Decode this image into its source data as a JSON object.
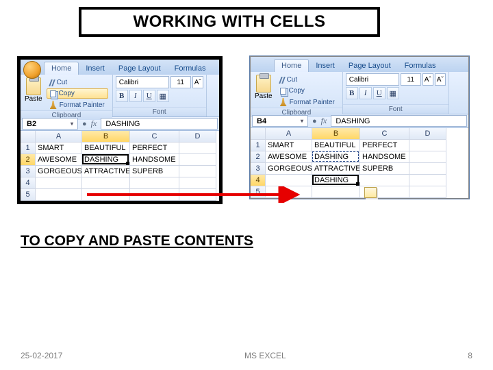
{
  "slide": {
    "title": "WORKING WITH CELLS",
    "subtitle": "TO COPY AND PASTE CONTENTS",
    "footer_date": "25-02-2017",
    "footer_center": "MS EXCEL",
    "footer_page": "8"
  },
  "ribbon": {
    "tabs": [
      "Home",
      "Insert",
      "Page Layout",
      "Formulas"
    ],
    "paste_label": "Paste",
    "cut_label": "Cut",
    "copy_label": "Copy",
    "fp_label": "Format Painter",
    "clipboard_group": "Clipboard",
    "font_group": "Font",
    "font_name": "Calibri",
    "font_size": "11",
    "btns": {
      "bold": "B",
      "italic": "I",
      "underline": "U",
      "grow": "Aˆ",
      "shrink": "Aˇ"
    }
  },
  "left": {
    "name_box": "B2",
    "formula": "DASHING",
    "cols": [
      "A",
      "B",
      "C",
      "D"
    ],
    "rows": [
      [
        "SMART",
        "BEAUTIFUL",
        "PERFECT",
        ""
      ],
      [
        "AWESOME",
        "DASHING",
        "HANDSOME",
        ""
      ],
      [
        "GORGEOUS",
        "ATTRACTIVE",
        "SUPERB",
        ""
      ],
      [
        "",
        "",
        "",
        ""
      ],
      [
        "",
        "",
        "",
        ""
      ]
    ],
    "sel_col": "B",
    "sel_row": 2
  },
  "right": {
    "name_box": "B4",
    "formula": "DASHING",
    "cols": [
      "A",
      "B",
      "C",
      "D"
    ],
    "rows": [
      [
        "SMART",
        "BEAUTIFUL",
        "PERFECT",
        ""
      ],
      [
        "AWESOME",
        "DASHING",
        "HANDSOME",
        ""
      ],
      [
        "GORGEOUS",
        "ATTRACTIVE",
        "SUPERB",
        ""
      ],
      [
        "",
        "DASHING",
        "",
        ""
      ],
      [
        "",
        "",
        "",
        ""
      ]
    ],
    "sel_col": "B",
    "sel_row": 4
  }
}
